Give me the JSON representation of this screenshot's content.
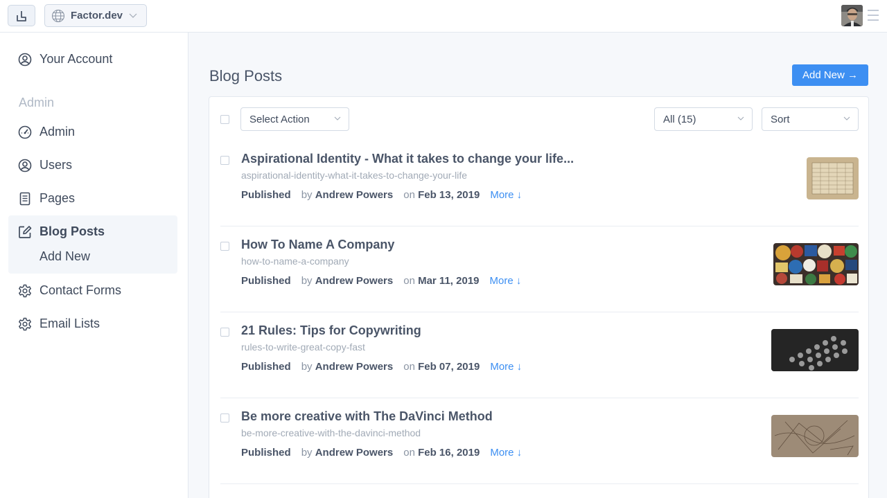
{
  "topbar": {
    "site_name": "Factor.dev",
    "icons": {
      "logo": "factor-logo-icon",
      "site": "globe-icon",
      "site_dropdown": "chevron-down-icon",
      "menu": "hamburger-menu-icon"
    }
  },
  "sidebar": {
    "account": {
      "label": "Your Account",
      "icon": "user-circle-icon"
    },
    "section_heading": "Admin",
    "items": [
      {
        "label": "Admin",
        "icon": "dashboard-gauge-icon"
      },
      {
        "label": "Users",
        "icon": "user-circle-icon"
      },
      {
        "label": "Pages",
        "icon": "document-icon"
      },
      {
        "label": "Blog Posts",
        "icon": "edit-icon",
        "active": true
      },
      {
        "label": "Contact Forms",
        "icon": "gear-icon"
      },
      {
        "label": "Email Lists",
        "icon": "gear-icon"
      }
    ],
    "sub_items": [
      "Add New"
    ]
  },
  "main": {
    "title": "Blog Posts",
    "add_new_label": "Add New →",
    "toolbar": {
      "bulk_action": "Select Action",
      "filter": "All (15)",
      "sort": "Sort"
    },
    "posts": [
      {
        "title": "Aspirational Identity - What it takes to change your life...",
        "slug": "aspirational-identity-what-it-takes-to-change-your-life",
        "status": "Published",
        "by_label": "by",
        "author": "Andrew Powers",
        "on_label": "on",
        "date": "Feb 13, 2019",
        "more_label": "More ↓",
        "thumb": "table-chart-paper-thumbnail"
      },
      {
        "title": "How To Name A Company",
        "slug": "how-to-name-a-company",
        "status": "Published",
        "by_label": "by",
        "author": "Andrew Powers",
        "on_label": "on",
        "date": "Mar 11, 2019",
        "more_label": "More ↓",
        "thumb": "patches-collage-thumbnail"
      },
      {
        "title": "21 Rules: Tips for Copywriting",
        "slug": "rules-to-write-great-copy-fast",
        "status": "Published",
        "by_label": "by",
        "author": "Andrew Powers",
        "on_label": "on",
        "date": "Feb 07, 2019",
        "more_label": "More ↓",
        "thumb": "typewriter-keys-thumbnail"
      },
      {
        "title": "Be more creative with The DaVinci Method",
        "slug": "be-more-creative-with-the-davinci-method",
        "status": "Published",
        "by_label": "by",
        "author": "Andrew Powers",
        "on_label": "on",
        "date": "Feb 16, 2019",
        "more_label": "More ↓",
        "thumb": "sketch-drawing-thumbnail"
      }
    ]
  },
  "colors": {
    "accent": "#3d8ff2",
    "text": "#3f4a5c",
    "muted": "#a1aab6",
    "background": "#f6f8fb"
  }
}
